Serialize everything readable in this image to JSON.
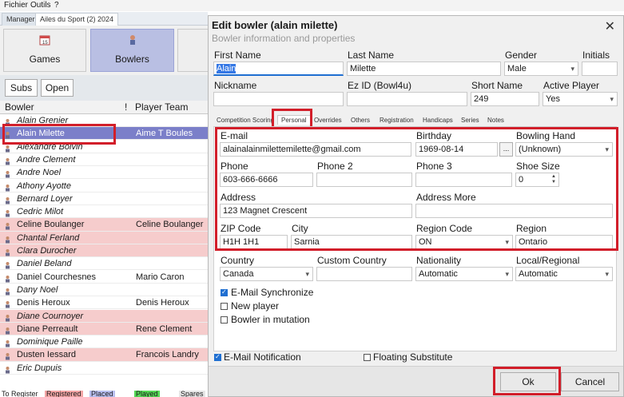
{
  "menu": [
    "Fichier",
    "Outils",
    "?"
  ],
  "app_tabs": [
    "Manager",
    "Ailes du Sport (2) 2024"
  ],
  "big_buttons": [
    "Games",
    "Bowlers"
  ],
  "toolbar": {
    "subs": "Subs",
    "open": "Open"
  },
  "grid": {
    "col_bowler": "Bowler",
    "col_flag": "!",
    "col_team": "Player Team",
    "rows": [
      {
        "name": "Alain Grenier",
        "team": "",
        "style": "italic"
      },
      {
        "name": "Alain Milette",
        "team": "Aime T Boules",
        "style": "selected"
      },
      {
        "name": "Alexandre Boivin",
        "team": "",
        "style": "italic"
      },
      {
        "name": "Andre  Clement",
        "team": "",
        "style": "italic"
      },
      {
        "name": "Andre Noel",
        "team": "",
        "style": "italic"
      },
      {
        "name": "Athony Ayotte",
        "team": "",
        "style": "italic"
      },
      {
        "name": "Bernard Loyer",
        "team": "",
        "style": "italic"
      },
      {
        "name": "Cedric Milot",
        "team": "",
        "style": "italic"
      },
      {
        "name": "Celine Boulanger",
        "team": "Celine Boulanger",
        "style": "pink"
      },
      {
        "name": "Chantal Ferland",
        "team": "",
        "style": "pink-italic"
      },
      {
        "name": "Clara Durocher",
        "team": "",
        "style": "pink-italic"
      },
      {
        "name": "Daniel Beland",
        "team": "",
        "style": "italic"
      },
      {
        "name": "Daniel Courchesnes",
        "team": "Mario Caron",
        "style": "normal"
      },
      {
        "name": "Dany Noel",
        "team": "",
        "style": "italic"
      },
      {
        "name": "Denis Heroux",
        "team": "Denis Heroux",
        "style": "normal"
      },
      {
        "name": "Diane Cournoyer",
        "team": "",
        "style": "pink-italic"
      },
      {
        "name": "Diane Perreault",
        "team": "Rene Clement",
        "style": "pink"
      },
      {
        "name": "Dominique Paille",
        "team": "",
        "style": "italic"
      },
      {
        "name": "Dusten Iessard",
        "team": "Francois Landry",
        "style": "pink"
      },
      {
        "name": "Eric Dupuis",
        "team": "",
        "style": "italic"
      }
    ]
  },
  "legend": [
    "To Register",
    "Registered",
    "Placed",
    "Played",
    "Spares"
  ],
  "legend_colors": [
    "#ffffff",
    "#f4a6a6",
    "#b9bff0",
    "#55d855",
    "#e6e6e6"
  ],
  "dialog": {
    "title": "Edit bowler (alain milette)",
    "subtitle": "Bowler information and properties",
    "first_name_label": "First Name",
    "first_name": "Alain",
    "last_name_label": "Last Name",
    "last_name": "Milette",
    "gender_label": "Gender",
    "gender": "Male",
    "initials_label": "Initials",
    "initials": "",
    "nickname_label": "Nickname",
    "nickname": "",
    "ezid_label": "Ez ID (Bowl4u)",
    "ezid": "",
    "short_name_label": "Short Name",
    "short_name": "249",
    "active_label": "Active Player",
    "active": "Yes",
    "tabs": [
      "Competition Scoring",
      "Personal",
      "Overrides",
      "Others",
      "Registration",
      "Handicaps",
      "Series",
      "Notes"
    ],
    "email_label": "E-mail",
    "email": "alainalainmilettemilette@gmail.com",
    "birthday_label": "Birthday",
    "birthday": "1969-08-14",
    "birthday_btn": "...",
    "hand_label": "Bowling Hand",
    "hand": "(Unknown)",
    "phone_label": "Phone",
    "phone": "603-666-6666",
    "phone2_label": "Phone 2",
    "phone2": "",
    "phone3_label": "Phone 3",
    "phone3": "",
    "shoe_label": "Shoe Size",
    "shoe": "0",
    "address_label": "Address",
    "address": "123 Magnet Crescent",
    "address_more_label": "Address More",
    "address_more": "",
    "zip_label": "ZIP Code",
    "zip": "H1H 1H1",
    "city_label": "City",
    "city": "Sarnia",
    "region_code_label": "Region Code",
    "region_code": "ON",
    "region_label": "Region",
    "region": "Ontario",
    "country_label": "Country",
    "country": "Canada",
    "custom_country_label": "Custom Country",
    "custom_country": "",
    "nationality_label": "Nationality",
    "nationality": "Automatic",
    "local_label": "Local/Regional",
    "local": "Automatic",
    "chk_email_sync": "E-Mail Synchronize",
    "chk_new_player": "New player",
    "chk_mutation": "Bowler in mutation",
    "chk_email_notif": "E-Mail Notification",
    "chk_floating": "Floating Substitute",
    "ok": "Ok",
    "cancel": "Cancel"
  },
  "colors": {
    "highlight_red": "#d21e2a",
    "selected_row": "#7b7fc9",
    "pink_row": "#f6cccc",
    "accent_blue": "#1f6fd1"
  }
}
